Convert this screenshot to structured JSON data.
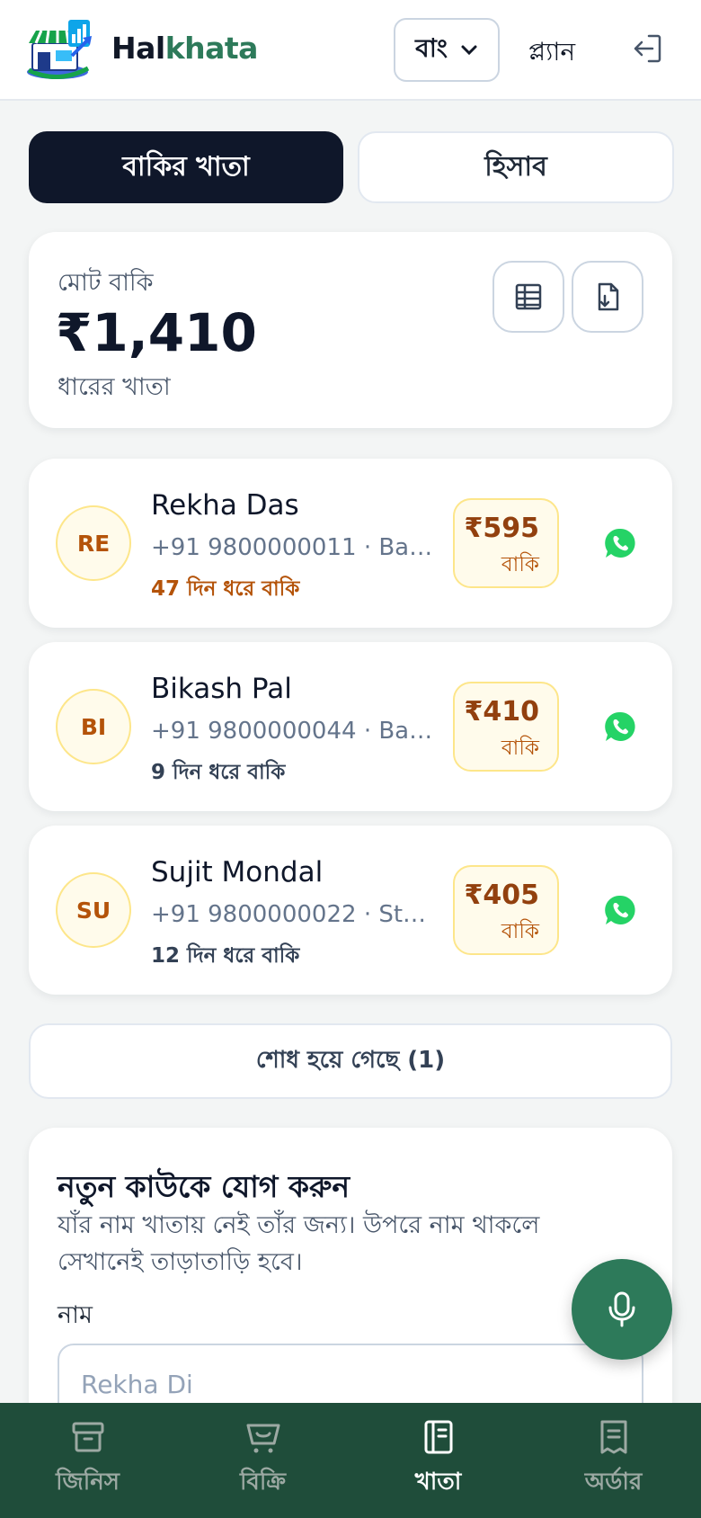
{
  "header": {
    "brand_part1": "Hal",
    "brand_part2": "khata",
    "language_selected": "বাং",
    "plan_label": "প্ল্যান"
  },
  "tabs": [
    {
      "label": "বাকির খাতা",
      "active": true
    },
    {
      "label": "হিসাব",
      "active": false
    }
  ],
  "summary": {
    "label": "মোট বাকি",
    "amount": "₹1,410",
    "subtitle": "ধারের খাতা"
  },
  "customers": [
    {
      "initials": "RE",
      "name": "Rekha Das",
      "phone": "+91 9800000011 · Baza...",
      "days": "47 দিন ধরে বাকি",
      "due": "₹595",
      "due_label": "বাকি",
      "overdue": true
    },
    {
      "initials": "BI",
      "name": "Bikash Pal",
      "phone": "+91 9800000044 · Baza...",
      "days": "9 দিন ধরে বাকি",
      "due": "₹410",
      "due_label": "বাকি",
      "overdue": false
    },
    {
      "initials": "SU",
      "name": "Sujit Mondal",
      "phone": "+91 9800000022 · Stati...",
      "days": "12 দিন ধরে বাকি",
      "due": "₹405",
      "due_label": "বাকি",
      "overdue": false
    }
  ],
  "settled": {
    "label": "শোধ হয়ে গেছে (1)"
  },
  "add_customer": {
    "title": "নতুন কাউকে যোগ করুন",
    "description": "যাঁর নাম খাতায় নেই তাঁর জন্য। উপরে নাম থাকলে সেখানেই তাড়াতাড়ি হবে।",
    "name_label": "নাম",
    "name_placeholder": "Rekha Di"
  },
  "bottom_nav": [
    {
      "label": "জিনিস",
      "icon": "box-icon",
      "active": false
    },
    {
      "label": "বিক্রি",
      "icon": "cart-icon",
      "active": false
    },
    {
      "label": "খাতা",
      "icon": "ledger-book-icon",
      "active": true
    },
    {
      "label": "অর্ডার",
      "icon": "receipt-icon",
      "active": false
    }
  ],
  "colors": {
    "brand_green": "#2d7a5a",
    "nav_bg": "#1f4d3a",
    "dark_tab": "#0f172a",
    "due_amber": "#92400e",
    "whatsapp": "#25d366"
  }
}
